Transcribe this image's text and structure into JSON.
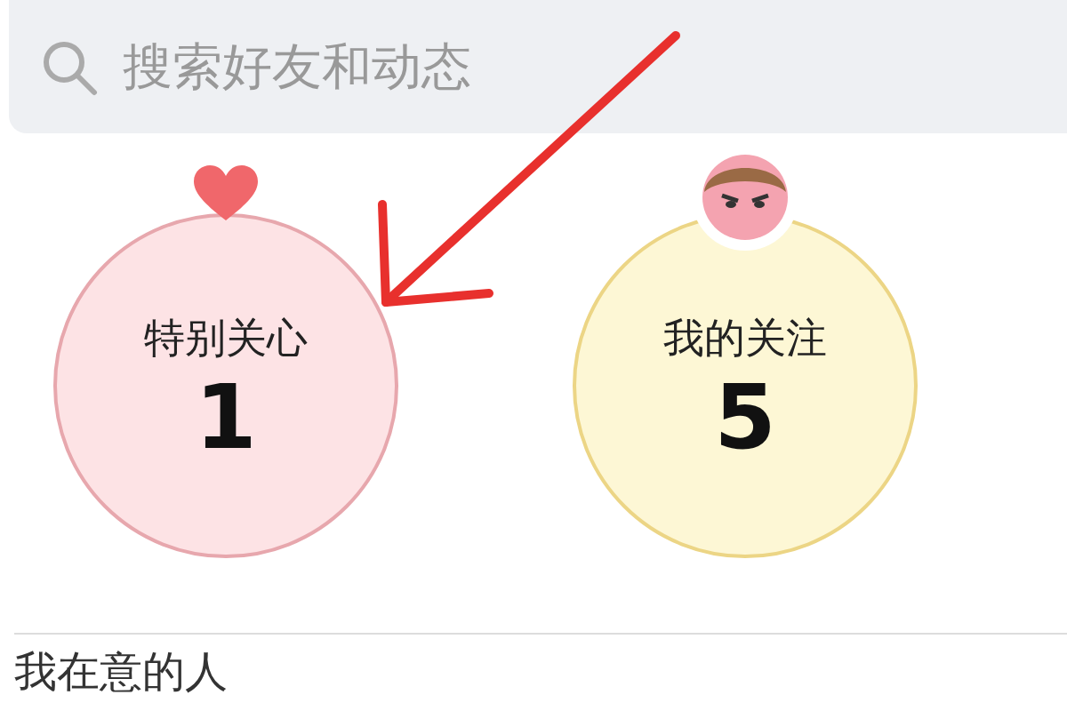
{
  "search": {
    "placeholder": "搜索好友和动态"
  },
  "groups": [
    {
      "kind": "special",
      "label": "特别关心",
      "count": "1"
    },
    {
      "kind": "following",
      "label": "我的关注",
      "count": "5"
    }
  ],
  "section": {
    "title": "我在意的人"
  }
}
